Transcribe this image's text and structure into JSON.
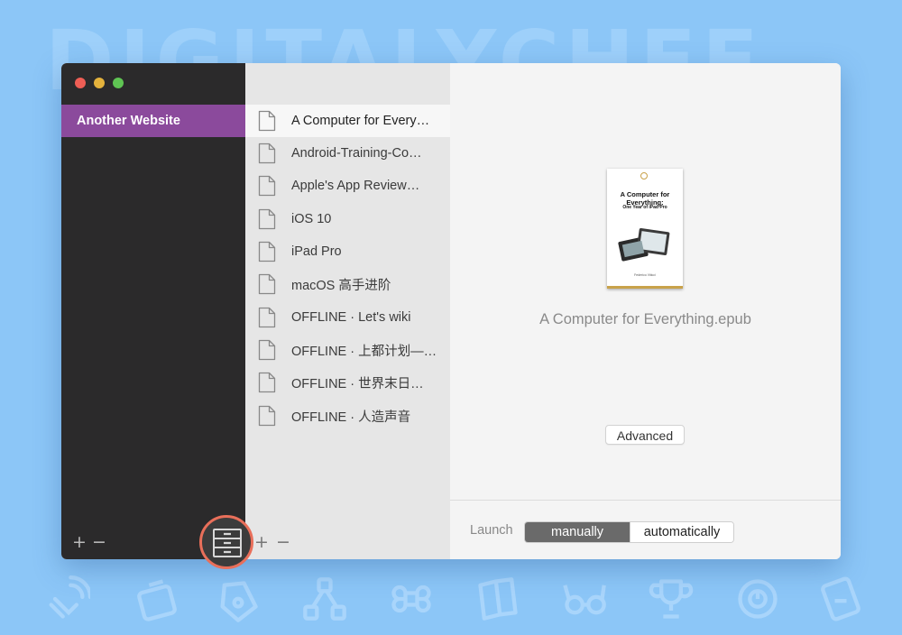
{
  "background": {
    "watermark": "DIGITALYCHEE",
    "icons": [
      "wifi-hand-icon",
      "box-icon",
      "tag-icon",
      "nodes-icon",
      "command-icon",
      "book-icon",
      "glasses-icon",
      "trophy-icon",
      "clock-icon",
      "card-icon"
    ]
  },
  "colors": {
    "accent": "#8b4a9c",
    "highlight": "#e96f5a",
    "segment_on": "#6a6a6a",
    "sidebar": "#2b2a2b"
  },
  "sidebar": {
    "items": [
      {
        "label": "Another Website"
      }
    ],
    "add_label": "+",
    "remove_label": "−"
  },
  "list": {
    "items": [
      {
        "label": "A Computer for Every…",
        "icon": "document-icon"
      },
      {
        "label": "Android-Training-Co…",
        "icon": "document-icon"
      },
      {
        "label": "Apple's App Review…",
        "icon": "document-icon"
      },
      {
        "label": "iOS 10",
        "icon": "document-icon"
      },
      {
        "label": "iPad Pro",
        "icon": "document-icon"
      },
      {
        "label": "macOS 高手进阶",
        "icon": "document-icon"
      },
      {
        "label": "OFFLINE · Let's wiki",
        "icon": "document-icon"
      },
      {
        "label": "OFFLINE · 上都计划—…",
        "icon": "document-icon"
      },
      {
        "label": "OFFLINE · 世界末日…",
        "icon": "document-icon"
      },
      {
        "label": "OFFLINE · 人造声音",
        "icon": "document-icon"
      }
    ],
    "add_label": "+",
    "remove_label": "−"
  },
  "detail": {
    "cover": {
      "title": "A Computer for Everything:",
      "subtitle": "One Year of iPad Pro",
      "author": "Federico Viticci"
    },
    "filename": "A Computer for Everything.epub",
    "advanced_label": "Advanced",
    "launch_label": "Launch",
    "launch_options": [
      "manually",
      "automatically"
    ],
    "launch_selected": "manually"
  },
  "toolbar": {
    "library_icon": "cabinet-icon"
  }
}
